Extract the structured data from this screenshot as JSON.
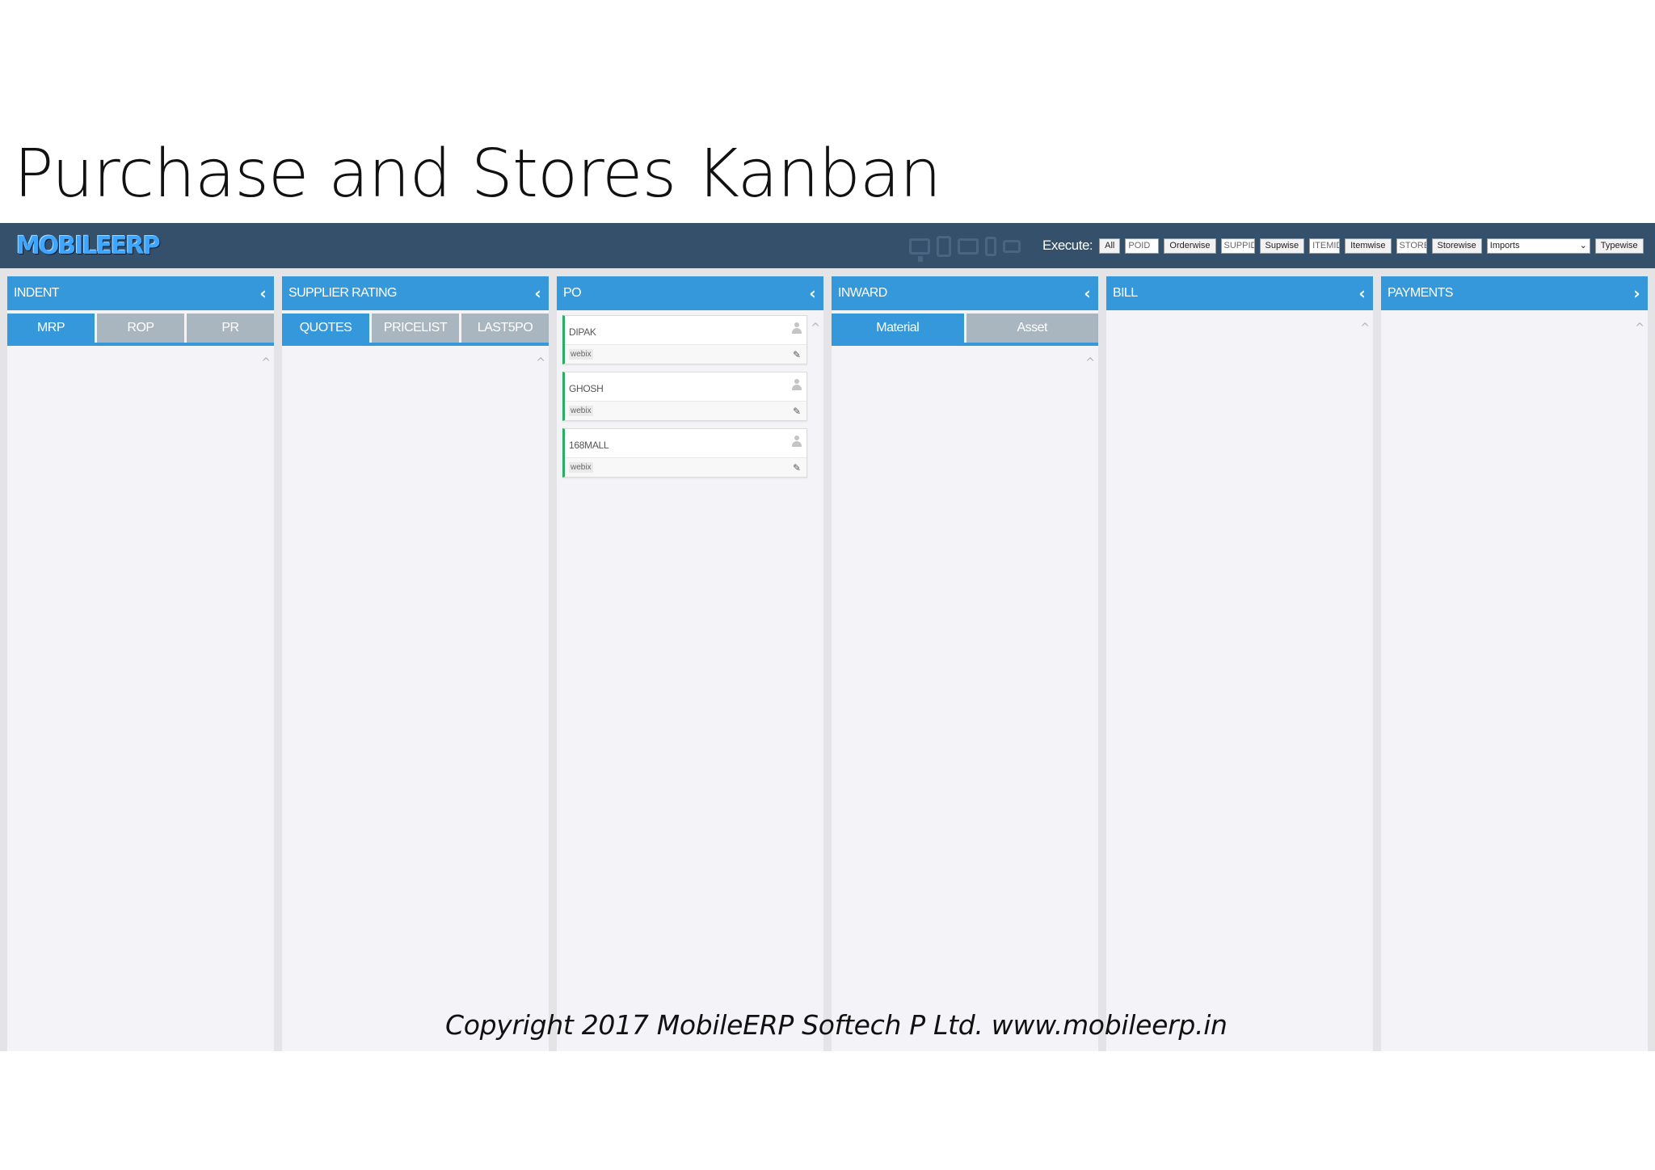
{
  "slide": {
    "title": "Purchase and Stores Kanban",
    "footer": "Copyright 2017 MobileERP Softech P Ltd. www.mobileerp.in"
  },
  "topbar": {
    "logo": "MOBILEERP",
    "device_icons": [
      "desktop-icon",
      "tablet-portrait-icon",
      "tablet-landscape-icon",
      "phone-portrait-icon",
      "phone-landscape-icon"
    ],
    "execute_label": "Execute:",
    "all_button": "All",
    "poid_input": "POID",
    "orderwise_button": "Orderwise",
    "suppid_input": "SUPPID",
    "supwise_button": "Supwise",
    "itemid_input": "ITEMID",
    "itemwise_button": "Itemwise",
    "store_input": "STORE",
    "storewise_button": "Storewise",
    "type_select": "Imports",
    "typewise_button": "Typewise"
  },
  "columns": {
    "indent": {
      "title": "INDENT",
      "arrow": "‹",
      "tabs": [
        "MRP",
        "ROP",
        "PR"
      ],
      "active_tab": "MRP"
    },
    "supplier_rating": {
      "title": "SUPPLIER RATING",
      "arrow": "‹",
      "tabs": [
        "QUOTES",
        "PRICELIST",
        "LAST5PO"
      ],
      "active_tab": "QUOTES"
    },
    "po": {
      "title": "PO",
      "arrow": "‹",
      "cards": [
        {
          "name": "DIPAK",
          "tag": "webix"
        },
        {
          "name": "GHOSH",
          "tag": "webix"
        },
        {
          "name": "168MALL",
          "tag": "webix"
        }
      ]
    },
    "inward": {
      "title": "INWARD",
      "arrow": "‹",
      "tabs": [
        "Material",
        "Asset"
      ],
      "active_tab": "Material"
    },
    "bill": {
      "title": "BILL",
      "arrow": "‹"
    },
    "payments": {
      "title": "PAYMENTS",
      "arrow": "›"
    }
  },
  "colors": {
    "topbar": "#34506b",
    "header_blue": "#3498db",
    "inactive_tab": "#a9b6bf",
    "card_accent": "#27ae60"
  }
}
